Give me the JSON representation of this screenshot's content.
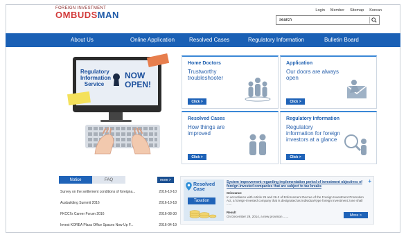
{
  "header": {
    "logo_top": "FOREIGN INVESTMENT",
    "logo_main_a": "OMBUDS",
    "logo_main_b": "MAN",
    "util_links": [
      "Login",
      "Member",
      "Sitemap",
      "Korean"
    ],
    "search_value": "search"
  },
  "nav": {
    "items": [
      "About Us",
      "Online Application",
      "Resolved Cases",
      "Regulatory Information",
      "Bulletin Board"
    ]
  },
  "hero": {
    "line1": "Regulatory Information Service",
    "line2": "NOW OPEN!"
  },
  "cards": [
    {
      "title": "Home Doctors",
      "desc": "Trustworthy troubleshooter",
      "button": "Click >"
    },
    {
      "title": "Application",
      "desc": "Our doors are always open",
      "button": "Click >"
    },
    {
      "title": "Resolved Cases",
      "desc": "How things are improved",
      "button": "Click >"
    },
    {
      "title": "Regulatory Information",
      "desc": "Regulatory information for foreign investors at a glance",
      "button": "Click >"
    }
  ],
  "notice": {
    "tabs": [
      "Notice",
      "FAQ"
    ],
    "more": "more >",
    "items": [
      {
        "title": "Survey on the settlement conditions of foreigna...",
        "date": "2016-10-10"
      },
      {
        "title": "Ausbuilding Summit 2016",
        "date": "2016-10-18"
      },
      {
        "title": "FKCCI's Career Forum 2016",
        "date": "2016-08-30"
      },
      {
        "title": "Invest KOREA Plaza Office Spaces Now Up F...",
        "date": "2016-04-19"
      }
    ]
  },
  "resolved": {
    "label": "Resolved Case",
    "category": "Taxation",
    "title": "System improvement regarding implementation period of investment objectives of foreign-invested companies that are subject to tax breaks",
    "grievance_label": "Grievance",
    "grievance_text": "In accordance with Article 25 and 26-2 of Enforcement Decree of the Foreign Investment Promotion Act, a foreign-invested company that is designated as individual-type foreign investment zone shall ......",
    "result_label": "Result",
    "result_text": "On December 29, 2014, a new provision ......",
    "more": "More >",
    "plus": "+"
  }
}
